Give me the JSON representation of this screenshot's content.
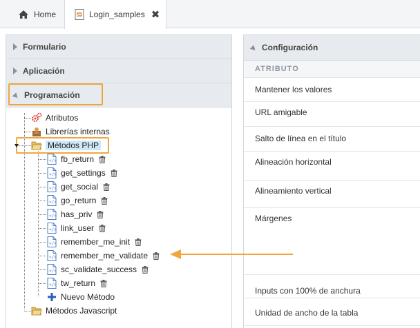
{
  "tabs": [
    {
      "label": "Home",
      "icon": "home-icon"
    },
    {
      "label": "Login_samples",
      "icon": "document-icon",
      "close": "✖"
    }
  ],
  "left_panel": {
    "sections": [
      {
        "label": "Formulario",
        "expanded": false
      },
      {
        "label": "Aplicación",
        "expanded": false
      },
      {
        "label": "Programación",
        "expanded": true
      }
    ],
    "tree": {
      "atributos": "Atributos",
      "librerias": "Librerías internas",
      "metodos_php": "Métodos PHP",
      "methods": [
        "fb_return",
        "get_settings",
        "get_social",
        "go_return",
        "has_priv",
        "link_user",
        "remember_me_init",
        "remember_me_validate",
        "sc_validate_success",
        "tw_return"
      ],
      "nuevo": "Nuevo Método",
      "metodos_js": "Métodos Javascript"
    }
  },
  "right_panel": {
    "title": "Configuración",
    "subheader": "ATRIBUTO",
    "rows": [
      "Mantener los valores",
      "URL amigable",
      "Salto de línea en el título",
      "Alineación horizontal",
      "Alineamiento vertical",
      "Márgenes",
      "Inputs con 100% de anchura",
      "Unidad de ancho de la tabla"
    ]
  },
  "colors": {
    "highlight": "#f0a63c",
    "arrow": "#f0a63c",
    "selection": "#cfe8f7",
    "header_bg": "#e7ebef"
  }
}
